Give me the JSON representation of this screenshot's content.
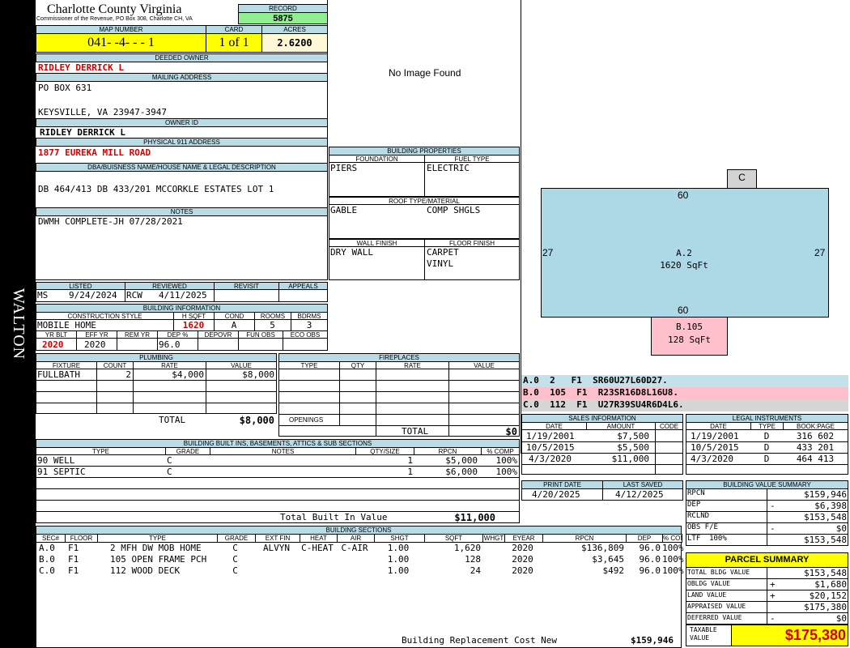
{
  "side": {
    "district": "WALTON"
  },
  "header": {
    "county": "Charlotte County Virginia",
    "commissioner": "Commissioner of the Revenue, PO Box 308, Charlotte CH, VA",
    "record_label": "RECORD",
    "record": "5875",
    "map_label": "MAP NUMBER",
    "map_number": "041- -4- - - 1",
    "card_label": "CARD",
    "card": "1 of 1",
    "acres_label": "ACRES",
    "acres": "2.6200"
  },
  "owner": {
    "deeded_label": "DEEDED OWNER",
    "deeded": "RIDLEY DERRICK L",
    "mailing_label": "MAILING ADDRESS",
    "address1": "PO BOX 631",
    "address2": "KEYSVILLE, VA 23947-3947",
    "owner_id_label": "OWNER ID",
    "owner_id": "RIDLEY DERRICK L",
    "physical_label": "PHYSICAL 911 ADDRESS",
    "physical": "1877 EUREKA MILL ROAD",
    "dba_label": "DBA/BUISNESS NAME/HOUSE NAME & LEGAL DESCRIPTION",
    "dba": "DB 464/413 DB 433/201 MCCORKLE ESTATES LOT 1",
    "notes_label": "NOTES",
    "notes": "DWMH COMPLETE-JH 07/28/2021"
  },
  "image": {
    "text": "No Image Found"
  },
  "props": {
    "title": "BUILDING PROPERTIES",
    "foundation_label": "FOUNDATION",
    "foundation": "PIERS",
    "fuel_label": "FUEL TYPE",
    "fuel": "ELECTRIC",
    "roof_label": "ROOF TYPE/MATERIAL",
    "roof1": "GABLE",
    "roof2": "COMP SHGLS",
    "wall_label": "WALL FINISH",
    "wall": "DRY WALL",
    "floor_label": "FLOOR FINISH",
    "floor1": "CARPET",
    "floor2": "VINYL"
  },
  "sketch": {
    "c_label": "C",
    "top": "60",
    "bottom": "60",
    "left": "27",
    "right": "27",
    "a_label": "A.2",
    "a_area": "1620 SqFt",
    "b_label": "B.105",
    "b_area": "128 SqFt"
  },
  "sections_codes": [
    {
      "text": "A.0  2   F1  SR60U27L60D27.",
      "color": "#c3e1ea"
    },
    {
      "text": "B.0  105  F1  R23SR16D8L16U8.",
      "color": "#ffc0cb"
    },
    {
      "text": "C.0  112  F1  U27R39SU4R6D4L6.",
      "color": "#d6d6d6"
    }
  ],
  "listing": {
    "listed_label": "LISTED",
    "listed_by": "MS",
    "listed_date": "9/24/2024",
    "reviewed_label": "REVIEWED",
    "reviewed_by": "RCW",
    "reviewed_date": "4/11/2025",
    "revisit_label": "REVISIT",
    "appeals_label": "APPEALS"
  },
  "building_info": {
    "title": "BUILDING INFORMATION",
    "style_label": "CONSTRUCTION STYLE",
    "style": "MOBILE HOME",
    "hsqft_label": "H SQFT",
    "hsqft": "1620",
    "cond_label": "COND",
    "cond": "A",
    "rooms_label": "ROOMS",
    "rooms": "5",
    "bdrms_label": "BDRMS",
    "bdrms": "3",
    "yrblt_label": "YR BLT",
    "yrblt": "2020",
    "effyr_label": "EFF YR",
    "effyr": "2020",
    "remyr_label": "REM YR",
    "dep_label": "DEP %",
    "dep": "96.0",
    "depovr_label": "DEPOVR",
    "funobs_label": "FUN OBS",
    "ecoobs_label": "ECO OBS"
  },
  "plumbing": {
    "title": "PLUMBING",
    "h_fixture": "FIXTURE",
    "h_count": "COUNT",
    "h_rate": "RATE",
    "h_value": "VALUE",
    "fixture": "FULLBATH",
    "count": "2",
    "rate": "$4,000",
    "value": "$8,000",
    "total_label": "TOTAL",
    "total": "$8,000"
  },
  "fireplaces": {
    "title": "FIREPLACES",
    "h_type": "TYPE",
    "h_qty": "QTY",
    "h_rate": "RATE",
    "h_value": "VALUE",
    "openings": "OPENINGS",
    "total_label": "TOTAL",
    "total": "$0"
  },
  "sales": {
    "title": "SALES INFORMATION",
    "h_date": "DATE",
    "h_amount": "AMOUNT",
    "h_code": "CODE",
    "rows": [
      [
        "1/19/2001",
        "$7,500"
      ],
      [
        "10/5/2015",
        "$5,500"
      ],
      [
        "4/3/2020",
        "$11,000"
      ]
    ]
  },
  "legal": {
    "title": "LEGAL INSTRUMENTS",
    "h_date": "DATE",
    "h_type": "TYPE",
    "h_book": "BOOK:PAGE",
    "rows": [
      [
        "1/19/2001",
        "D",
        "316 602"
      ],
      [
        "10/5/2015",
        "D",
        "433 201"
      ],
      [
        "4/3/2020",
        "D",
        "464 413"
      ]
    ]
  },
  "print": {
    "print_label": "PRINT DATE",
    "print_date": "4/20/2025",
    "saved_label": "LAST SAVED",
    "saved_date": "4/12/2025"
  },
  "builtins": {
    "title": "BUILDING BUILT INS, BASEMENTS, ATTICS & SUB SECTIONS",
    "h_type": "TYPE",
    "h_grade": "GRADE",
    "h_notes": "NOTES",
    "h_qty": "QTY/SIZE",
    "h_rpcn": "RPCN",
    "h_comp": "% COMP",
    "rows": [
      [
        "90 WELL",
        "C",
        "1",
        "$5,000",
        "100%"
      ],
      [
        "91 SEPTIC",
        "C",
        "1",
        "$6,000",
        "100%"
      ]
    ],
    "total_label": "Total Built In Value",
    "total": "$11,000"
  },
  "bvs": {
    "title": "BUILDING VALUE SUMMARY",
    "rows": [
      [
        "RPCN",
        "",
        "$159,946"
      ],
      [
        "DEP",
        "-",
        "$6,398"
      ],
      [
        "RCLND",
        "",
        "$153,548"
      ],
      [
        "OBS F/E",
        "-",
        "$0"
      ],
      [
        "LTF  100%",
        "",
        "$153,548"
      ]
    ]
  },
  "parcel": {
    "title": "PARCEL SUMMARY",
    "rows": [
      [
        "TOTAL BLDG VALUE",
        "",
        "$153,548"
      ],
      [
        "OBLDG VALUE",
        "+",
        "$1,680"
      ],
      [
        "LAND VALUE",
        "+",
        "$20,152"
      ],
      [
        "APPRAISED VALUE",
        "",
        "$175,380"
      ],
      [
        "DEFERRED VALUE",
        "-",
        "$0"
      ]
    ],
    "taxable_label": "TAXABLE VALUE",
    "taxable": "$175,380"
  },
  "sections": {
    "title": "BUILDING SECTIONS",
    "headers": [
      "SEC#",
      "FLOOR",
      "TYPE",
      "GRADE",
      "EXT FIN",
      "HEAT",
      "AIR",
      "SHGT",
      "SQFT",
      "WHGT",
      "EYEAR",
      "RPCN",
      "DEP",
      "% COMP"
    ],
    "rows": [
      [
        "A.0",
        "F1",
        "2 MFH DW MOB HOME",
        "C",
        "ALVYN",
        "C-HEAT",
        "C-AIR",
        "1.00",
        "1,620",
        "",
        "2020",
        "$136,809",
        "96.0",
        "100%"
      ],
      [
        "B.0",
        "F1",
        "105 OPEN FRAME PCH",
        "C",
        "",
        "",
        "",
        "1.00",
        "128",
        "",
        "2020",
        "$3,645",
        "96.0",
        "100%"
      ],
      [
        "C.0",
        "F1",
        "112 WOOD DECK",
        "C",
        "",
        "",
        "",
        "1.00",
        "24",
        "",
        "2020",
        "$492",
        "96.0",
        "100%"
      ]
    ],
    "brcn_label": "Building Replacement Cost New",
    "brcn": "$159,946"
  }
}
